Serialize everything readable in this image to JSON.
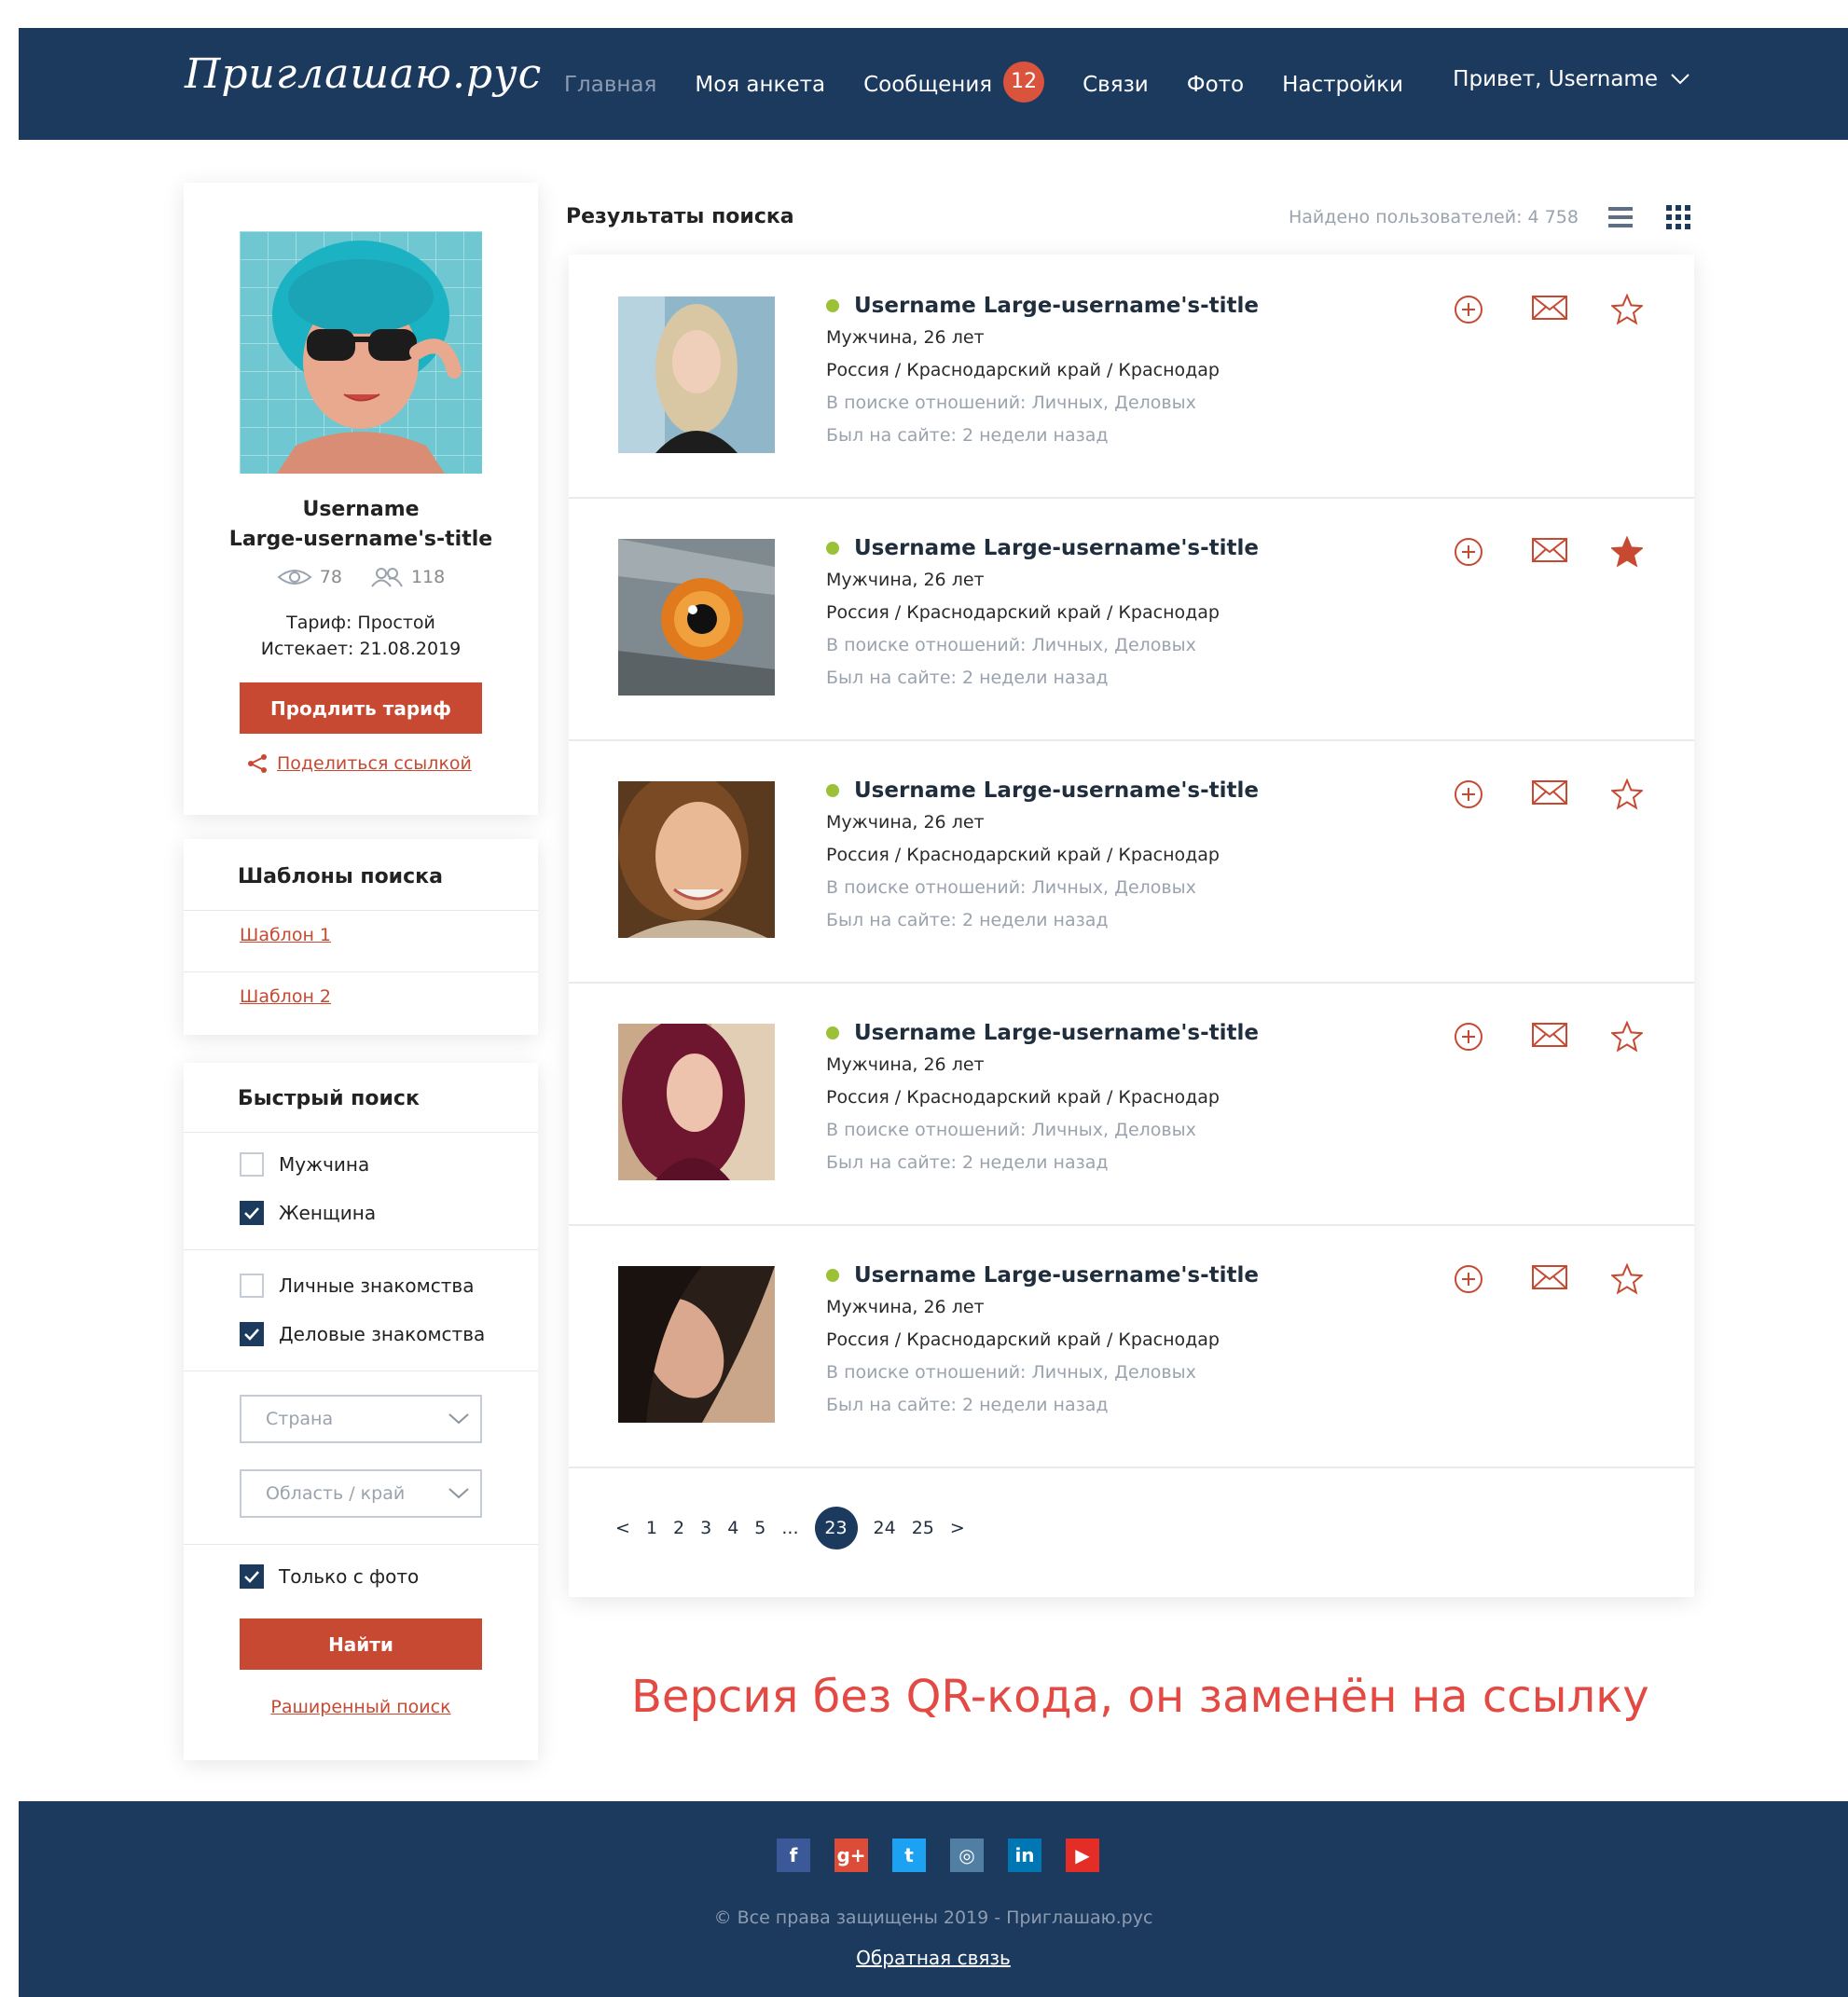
{
  "brand": {
    "logo": "Приглашаю.рус"
  },
  "nav": {
    "items": [
      {
        "label": "Главная",
        "active": true
      },
      {
        "label": "Моя анкета"
      },
      {
        "label": "Сообщения",
        "badge": "12"
      },
      {
        "label": "Связи"
      },
      {
        "label": "Фото"
      },
      {
        "label": "Настройки"
      }
    ],
    "greeting": "Привет, Username"
  },
  "profile": {
    "name_line1": "Username",
    "name_line2": "Large-username's-title",
    "views": "78",
    "contacts": "118",
    "tariff": "Тариф: Простой",
    "expires": "Истекает: 21.08.2019",
    "extend_button": "Продлить тариф",
    "share_link": "Поделиться ссылкой"
  },
  "templates": {
    "title": "Шаблоны поиска",
    "items": [
      "Шаблон 1",
      "Шаблон 2"
    ]
  },
  "quick_search": {
    "title": "Быстрый поиск",
    "gender": [
      {
        "label": "Мужчина",
        "checked": false
      },
      {
        "label": "Женщина",
        "checked": true
      }
    ],
    "purpose": [
      {
        "label": "Личные знакомства",
        "checked": false
      },
      {
        "label": "Деловые знакомства",
        "checked": true
      }
    ],
    "country_placeholder": "Страна",
    "region_placeholder": "Область / край",
    "only_photo": {
      "label": "Только с фото",
      "checked": true
    },
    "find_button": "Найти",
    "advanced_link": "Раширенный поиск"
  },
  "results": {
    "title": "Результаты поиска",
    "found": "Найдено пользователей: 4 758",
    "items": [
      {
        "name": "Username Large-username's-title",
        "gender_age": "Мужчина, 26 лет",
        "location": "Россия / Краснодарский край / Краснодар",
        "looking": "В поиске отношений: Личных, Деловых",
        "last_seen": "Был на сайте: 2 недели назад",
        "favorite": false
      },
      {
        "name": "Username Large-username's-title",
        "gender_age": "Мужчина, 26 лет",
        "location": "Россия / Краснодарский край / Краснодар",
        "looking": "В поиске отношений: Личных, Деловых",
        "last_seen": "Был на сайте: 2 недели назад",
        "favorite": true
      },
      {
        "name": "Username Large-username's-title",
        "gender_age": "Мужчина, 26 лет",
        "location": "Россия / Краснодарский край / Краснодар",
        "looking": "В поиске отношений: Личных, Деловых",
        "last_seen": "Был на сайте: 2 недели назад",
        "favorite": false
      },
      {
        "name": "Username Large-username's-title",
        "gender_age": "Мужчина, 26 лет",
        "location": "Россия / Краснодарский край / Краснодар",
        "looking": "В поиске отношений: Личных, Деловых",
        "last_seen": "Был на сайте: 2 недели назад",
        "favorite": false
      },
      {
        "name": "Username Large-username's-title",
        "gender_age": "Мужчина, 26 лет",
        "location": "Россия / Краснодарский край / Краснодар",
        "looking": "В поиске отношений: Личных, Деловых",
        "last_seen": "Был на сайте: 2 недели назад",
        "favorite": false
      }
    ]
  },
  "pagination": {
    "prev": "<",
    "pages": [
      "1",
      "2",
      "3",
      "4",
      "5",
      "...",
      "23",
      "24",
      "25"
    ],
    "current": "23",
    "next": ">"
  },
  "note": "Версия без QR-кода, он заменён на ссылку",
  "footer": {
    "socials": [
      {
        "icon": "facebook-icon",
        "glyph": "f",
        "color": "#3b5998"
      },
      {
        "icon": "google-plus-icon",
        "glyph": "g+",
        "color": "#dd4b39"
      },
      {
        "icon": "twitter-icon",
        "glyph": "t",
        "color": "#1da1f2"
      },
      {
        "icon": "instagram-icon",
        "glyph": "◎",
        "color": "#517fa4"
      },
      {
        "icon": "linkedin-icon",
        "glyph": "in",
        "color": "#0077b5"
      },
      {
        "icon": "youtube-icon",
        "glyph": "▶",
        "color": "#e52d27"
      }
    ],
    "copyright": "© Все права защищены 2019 - Приглашаю.рус",
    "feedback": "Обратная связь"
  },
  "colors": {
    "header": "#1b3a5e",
    "accent": "#c84932",
    "online": "#9bc137",
    "note": "#e34a43"
  }
}
